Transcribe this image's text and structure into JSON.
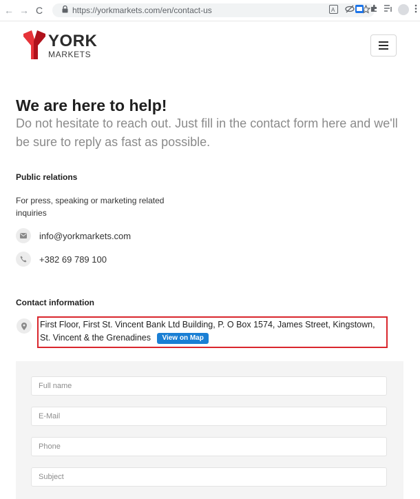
{
  "browser": {
    "url": "https://yorkmarkets.com/en/contact-us",
    "back_glyph": "←",
    "forward_glyph": "→",
    "reload_glyph": "C",
    "lock_glyph": "🔒"
  },
  "site": {
    "logo_name": "YORK",
    "logo_sub": "MARKETS",
    "brand_colors": {
      "logo_dark": "#b0121c",
      "logo_light": "#e63339"
    }
  },
  "hero": {
    "title": "We are here to help!",
    "subtitle": "Do not hesitate to reach out. Just fill in the contact form here and we'll be sure to reply as fast as possible."
  },
  "public_relations": {
    "heading": "Public relations",
    "description": "For press, speaking or marketing related inquiries",
    "email": "info@yorkmarkets.com",
    "phone": "+382 69 789 100"
  },
  "contact_info": {
    "heading": "Contact information",
    "address": "First Floor, First St. Vincent Bank Ltd Building, P. O Box 1574, James Street, Kingstown, St. Vincent & the Grenadines",
    "map_button": "View on Map",
    "highlight_color": "#d9262c",
    "button_color": "#1a7fd4"
  },
  "form": {
    "fields": [
      {
        "placeholder": "Full name",
        "value": ""
      },
      {
        "placeholder": "E-Mail",
        "value": ""
      },
      {
        "placeholder": "Phone",
        "value": ""
      },
      {
        "placeholder": "Subject",
        "value": ""
      }
    ]
  }
}
